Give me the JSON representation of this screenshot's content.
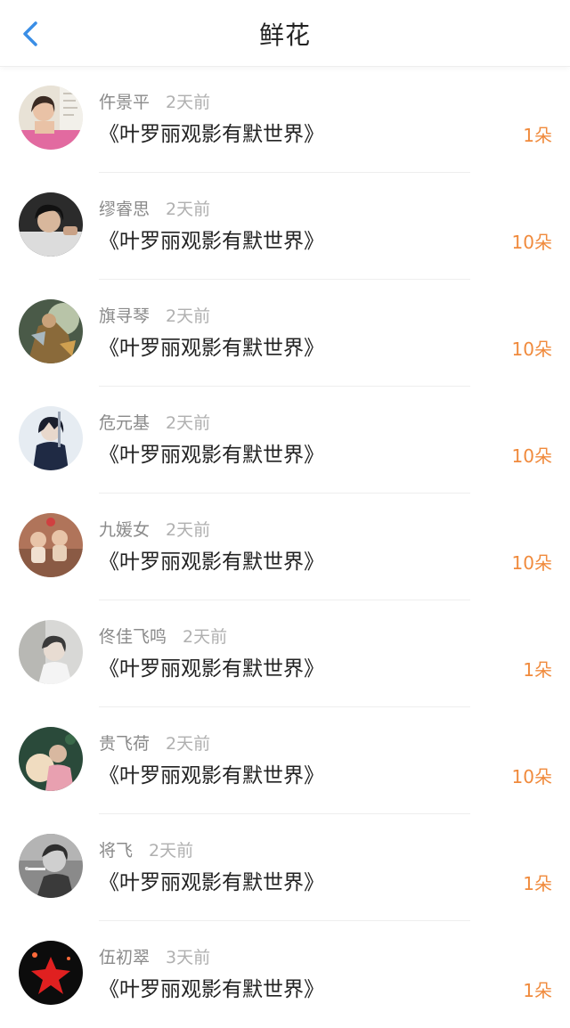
{
  "header": {
    "title": "鲜花",
    "back_icon": "chevron-left-icon"
  },
  "colors": {
    "accent": "#3a8ee6",
    "count": "#f08a3c",
    "name": "#8a8a8a",
    "time": "#b0b0b0",
    "text": "#222222"
  },
  "items": [
    {
      "name": "仵景平",
      "time": "2天前",
      "book": "《叶罗丽观影有默世界》",
      "count": "1朵",
      "avatar": "avatar-girl-pink"
    },
    {
      "name": "缪睿思",
      "time": "2天前",
      "book": "《叶罗丽观影有默世界》",
      "count": "10朵",
      "avatar": "avatar-boy-dark"
    },
    {
      "name": "旗寻琴",
      "time": "2天前",
      "book": "《叶罗丽观影有默世界》",
      "count": "10朵",
      "avatar": "avatar-fantasy-warrior"
    },
    {
      "name": "危元基",
      "time": "2天前",
      "book": "《叶罗丽观影有默世界》",
      "count": "10朵",
      "avatar": "avatar-anime-boy"
    },
    {
      "name": "九媛女",
      "time": "2天前",
      "book": "《叶罗丽观影有默世界》",
      "count": "10朵",
      "avatar": "avatar-babies"
    },
    {
      "name": "佟佳飞鸣",
      "time": "2天前",
      "book": "《叶罗丽观影有默世界》",
      "count": "1朵",
      "avatar": "avatar-boy-light"
    },
    {
      "name": "贵飞荷",
      "time": "2天前",
      "book": "《叶罗丽观影有默世界》",
      "count": "10朵",
      "avatar": "avatar-child-lantern"
    },
    {
      "name": "将飞",
      "time": "2天前",
      "book": "《叶罗丽观影有默世界》",
      "count": "1朵",
      "avatar": "avatar-smoking-man"
    },
    {
      "name": "伍初翠",
      "time": "3天前",
      "book": "《叶罗丽观影有默世界》",
      "count": "1朵",
      "avatar": "avatar-red-star"
    }
  ]
}
